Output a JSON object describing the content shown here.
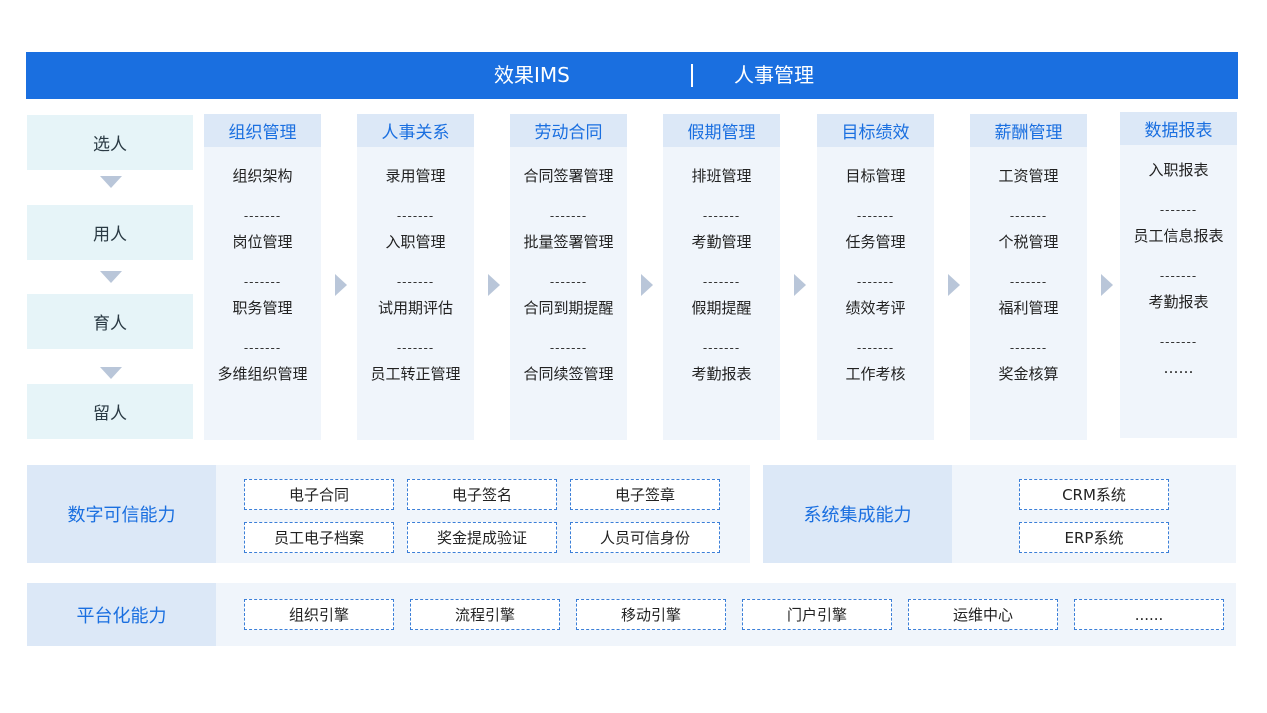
{
  "header": {
    "product": "效果IMS",
    "module": "人事管理"
  },
  "stages": [
    "选人",
    "用人",
    "育人",
    "留人"
  ],
  "columns": [
    {
      "title": "组织管理",
      "items": [
        "组织架构",
        "岗位管理",
        "职务管理",
        "多维组织管理"
      ]
    },
    {
      "title": "人事关系",
      "items": [
        "录用管理",
        "入职管理",
        "试用期评估",
        "员工转正管理"
      ]
    },
    {
      "title": "劳动合同",
      "items": [
        "合同签署管理",
        "批量签署管理",
        "合同到期提醒",
        "合同续签管理"
      ]
    },
    {
      "title": "假期管理",
      "items": [
        "排班管理",
        "考勤管理",
        "假期提醒",
        "考勤报表"
      ]
    },
    {
      "title": "目标绩效",
      "items": [
        "目标管理",
        "任务管理",
        "绩效考评",
        "工作考核"
      ]
    },
    {
      "title": "薪酬管理",
      "items": [
        "工资管理",
        "个税管理",
        "福利管理",
        "奖金核算"
      ]
    },
    {
      "title": "数据报表",
      "items": [
        "入职报表",
        "员工信息报表",
        "考勤报表",
        "……"
      ]
    }
  ],
  "separator": "-------",
  "digital_trust": {
    "label": "数字可信能力",
    "chips": [
      "电子合同",
      "电子签名",
      "电子签章",
      "员工电子档案",
      "奖金提成验证",
      "人员可信身份"
    ]
  },
  "integration": {
    "label": "系统集成能力",
    "chips": [
      "CRM系统",
      "ERP系统"
    ]
  },
  "platform": {
    "label": "平台化能力",
    "chips": [
      "组织引擎",
      "流程引擎",
      "移动引擎",
      "门户引擎",
      "运维中心",
      "......"
    ]
  }
}
